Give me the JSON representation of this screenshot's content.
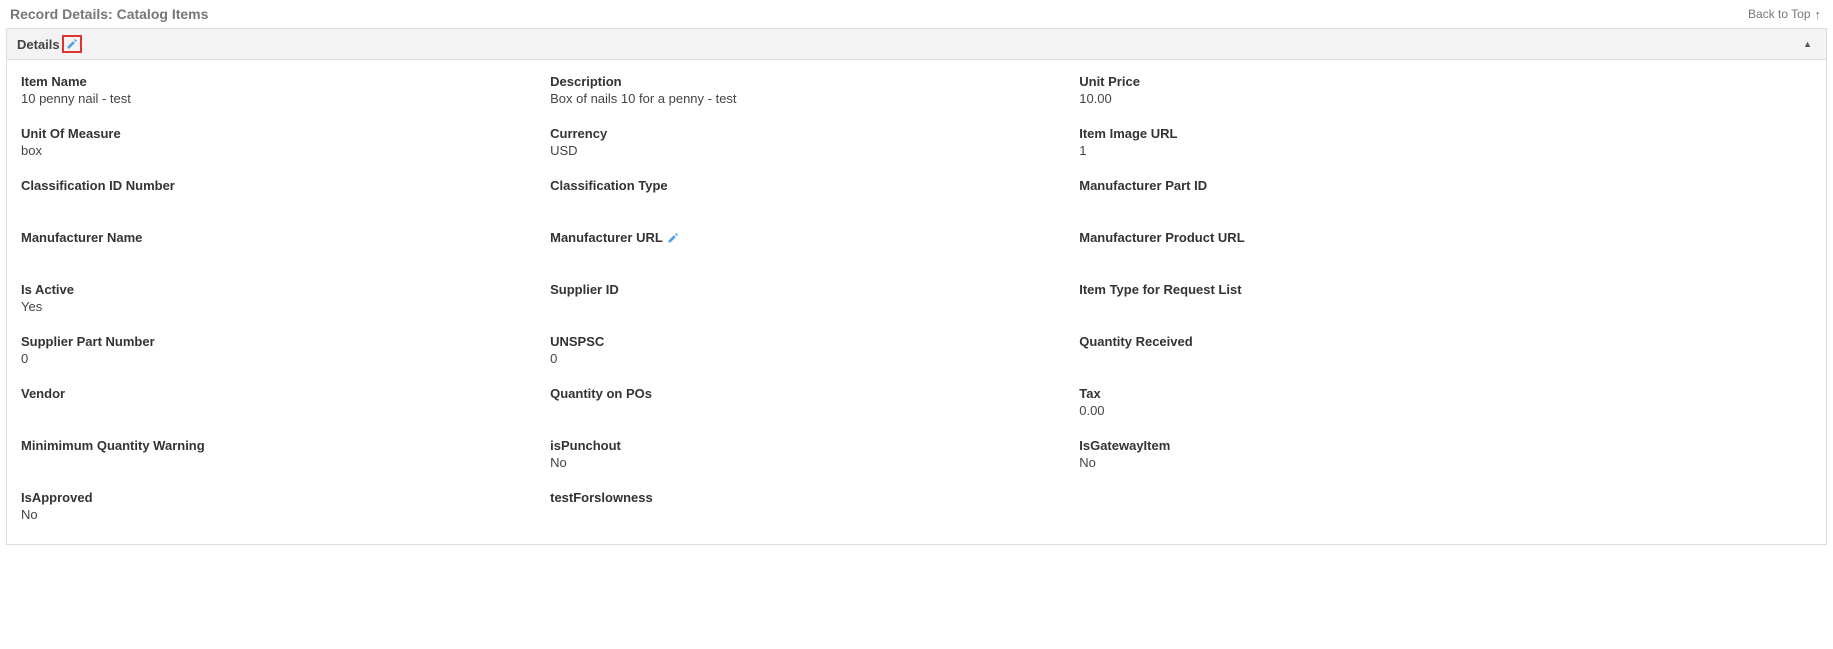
{
  "header": {
    "title": "Record Details: Catalog Items",
    "back_to_top": "Back to Top"
  },
  "section": {
    "title": "Details"
  },
  "fields": {
    "item_name": {
      "label": "Item Name",
      "value": "10 penny nail - test"
    },
    "description": {
      "label": "Description",
      "value": "Box of nails 10 for a penny - test"
    },
    "unit_price": {
      "label": "Unit Price",
      "value": "10.00"
    },
    "unit_of_measure": {
      "label": "Unit Of Measure",
      "value": "box"
    },
    "currency": {
      "label": "Currency",
      "value": "USD"
    },
    "item_image_url": {
      "label": "Item Image URL",
      "value": "1"
    },
    "classification_id": {
      "label": "Classification ID Number",
      "value": ""
    },
    "classification_type": {
      "label": "Classification Type",
      "value": ""
    },
    "manufacturer_part_id": {
      "label": "Manufacturer Part ID",
      "value": ""
    },
    "manufacturer_name": {
      "label": "Manufacturer Name",
      "value": ""
    },
    "manufacturer_url": {
      "label": "Manufacturer URL",
      "value": ""
    },
    "manufacturer_product_url": {
      "label": "Manufacturer Product URL",
      "value": ""
    },
    "is_active": {
      "label": "Is Active",
      "value": "Yes"
    },
    "supplier_id": {
      "label": "Supplier ID",
      "value": ""
    },
    "item_type_request_list": {
      "label": "Item Type for Request List",
      "value": ""
    },
    "supplier_part_number": {
      "label": "Supplier Part Number",
      "value": "0"
    },
    "unspsc": {
      "label": "UNSPSC",
      "value": "0"
    },
    "quantity_received": {
      "label": "Quantity Received",
      "value": ""
    },
    "vendor": {
      "label": "Vendor",
      "value": ""
    },
    "quantity_on_pos": {
      "label": "Quantity on POs",
      "value": ""
    },
    "tax": {
      "label": "Tax",
      "value": "0.00"
    },
    "min_qty_warning": {
      "label": "Minimimum Quantity Warning",
      "value": ""
    },
    "is_punchout": {
      "label": "isPunchout",
      "value": "No"
    },
    "is_gateway_item": {
      "label": "IsGatewayItem",
      "value": "No"
    },
    "is_approved": {
      "label": "IsApproved",
      "value": "No"
    },
    "test_for_slowness": {
      "label": "testForslowness",
      "value": ""
    }
  }
}
